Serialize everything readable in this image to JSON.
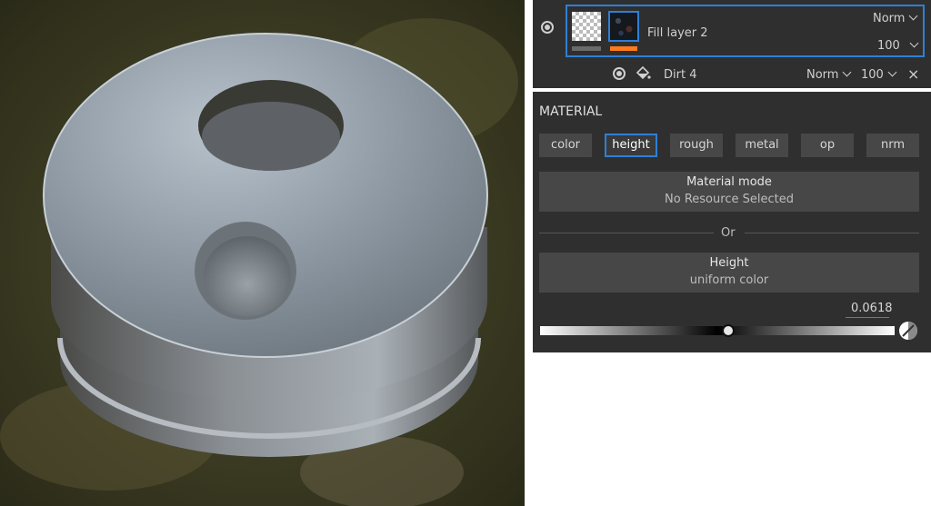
{
  "layers": {
    "fill_layer": {
      "name": "Fill layer 2",
      "blend": "Norm",
      "opacity": "100"
    },
    "dirt_layer": {
      "name": "Dirt 4",
      "blend": "Norm",
      "opacity": "100",
      "close": "×"
    }
  },
  "material": {
    "title": "MATERIAL",
    "channels": [
      "color",
      "height",
      "rough",
      "metal",
      "op",
      "nrm"
    ],
    "active_channel": "height",
    "mode": {
      "label": "Material mode",
      "value": "No Resource Selected"
    },
    "separator": "Or",
    "height": {
      "label": "Height",
      "value": "uniform color"
    },
    "slider": {
      "value": "0.0618",
      "position": 0.53
    }
  },
  "colors": {
    "accent": "#2f7fd6",
    "orange": "#ff7b1c",
    "panel": "#2f2f2f",
    "button": "#474747"
  }
}
